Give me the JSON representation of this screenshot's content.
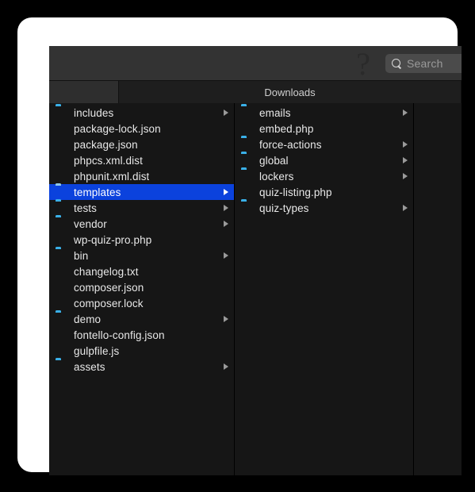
{
  "window": {
    "title_bar_help_icon": "?",
    "toolbar": {
      "help_label": "?",
      "search": {
        "placeholder": "Search",
        "value": "",
        "icon": "search-icon"
      }
    },
    "tabs": [
      {
        "label": "",
        "active": true
      },
      {
        "label": "Downloads",
        "active": false
      }
    ]
  },
  "colors": {
    "selection": "#0b42dd",
    "folder": "#3ab0e8",
    "code_file": "#4cb551",
    "window_bg": "#1b1b1b",
    "list_bg": "#161616",
    "toolbar_bg": "#333333",
    "frame": "#ffffff"
  },
  "columns": [
    {
      "name": "column-1",
      "items": [
        {
          "label": "includes",
          "icon": "folder-icon",
          "has_children": true,
          "selected": false
        },
        {
          "label": "package-lock.json",
          "icon": "json-file-icon",
          "has_children": false,
          "selected": false
        },
        {
          "label": "package.json",
          "icon": "json-file-icon",
          "has_children": false,
          "selected": false
        },
        {
          "label": "phpcs.xml.dist",
          "icon": "code-file-icon",
          "has_children": false,
          "selected": false
        },
        {
          "label": "phpunit.xml.dist",
          "icon": "code-file-icon",
          "has_children": false,
          "selected": false
        },
        {
          "label": "templates",
          "icon": "folder-icon",
          "has_children": true,
          "selected": true
        },
        {
          "label": "tests",
          "icon": "folder-icon",
          "has_children": true,
          "selected": false
        },
        {
          "label": "vendor",
          "icon": "folder-icon",
          "has_children": true,
          "selected": false
        },
        {
          "label": "wp-quiz-pro.php",
          "icon": "code-file-icon",
          "has_children": false,
          "selected": false
        },
        {
          "label": "bin",
          "icon": "folder-icon",
          "has_children": true,
          "selected": false
        },
        {
          "label": "changelog.txt",
          "icon": "doc-file-icon",
          "has_children": false,
          "selected": false
        },
        {
          "label": "composer.json",
          "icon": "json-file-icon",
          "has_children": false,
          "selected": false
        },
        {
          "label": "composer.lock",
          "icon": "doc-file-icon",
          "has_children": false,
          "selected": false
        },
        {
          "label": "demo",
          "icon": "folder-icon",
          "has_children": true,
          "selected": false
        },
        {
          "label": "fontello-config.json",
          "icon": "json-file-icon",
          "has_children": false,
          "selected": false
        },
        {
          "label": "gulpfile.js",
          "icon": "code-file-icon",
          "has_children": false,
          "selected": false
        },
        {
          "label": "assets",
          "icon": "folder-icon",
          "has_children": true,
          "selected": false
        }
      ]
    },
    {
      "name": "column-2",
      "items": [
        {
          "label": "emails",
          "icon": "folder-icon",
          "has_children": true,
          "selected": false
        },
        {
          "label": "embed.php",
          "icon": "code-file-icon",
          "has_children": false,
          "selected": false
        },
        {
          "label": "force-actions",
          "icon": "folder-icon",
          "has_children": true,
          "selected": false
        },
        {
          "label": "global",
          "icon": "folder-icon",
          "has_children": true,
          "selected": false
        },
        {
          "label": "lockers",
          "icon": "folder-icon",
          "has_children": true,
          "selected": false
        },
        {
          "label": "quiz-listing.php",
          "icon": "code-file-icon",
          "has_children": false,
          "selected": false
        },
        {
          "label": "quiz-types",
          "icon": "folder-icon",
          "has_children": true,
          "selected": false
        }
      ]
    },
    {
      "name": "column-3",
      "items": []
    }
  ]
}
